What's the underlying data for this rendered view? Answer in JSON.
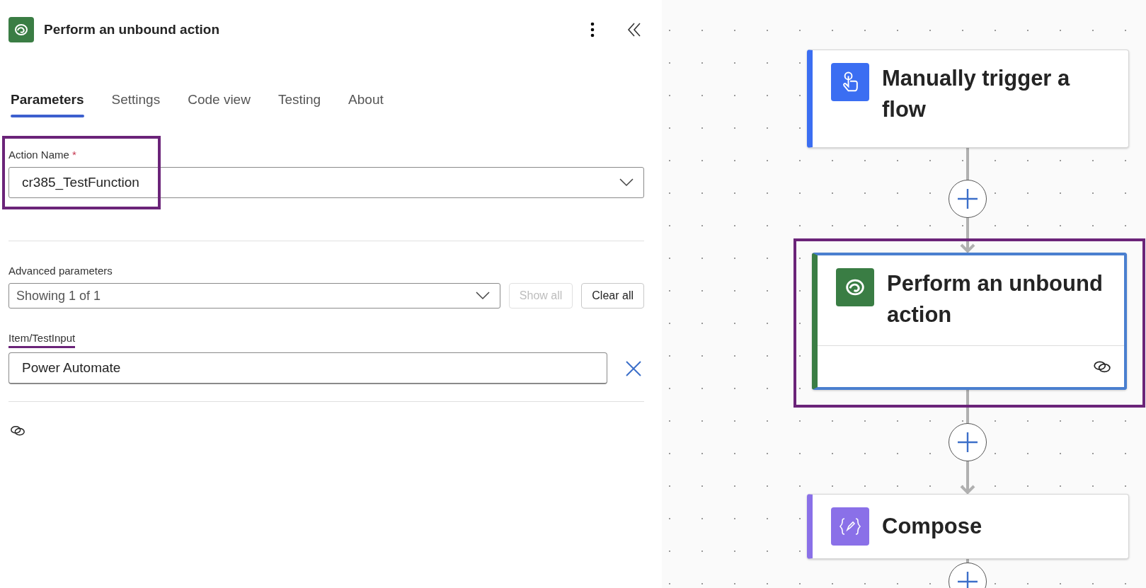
{
  "panel": {
    "title": "Perform an unbound action",
    "tabs": [
      {
        "label": "Parameters",
        "selected": true
      },
      {
        "label": "Settings",
        "selected": false
      },
      {
        "label": "Code view",
        "selected": false
      },
      {
        "label": "Testing",
        "selected": false
      },
      {
        "label": "About",
        "selected": false
      }
    ],
    "action_name": {
      "label": "Action Name",
      "required": "*",
      "value": "cr385_TestFunction",
      "annotated": true
    },
    "advanced": {
      "label": "Advanced parameters",
      "value": "Showing 1 of 1",
      "buttons": [
        {
          "label": "Show all",
          "disabled": true
        },
        {
          "label": "Clear all",
          "disabled": false
        }
      ]
    },
    "item_input": {
      "label": "Item/TestInput",
      "value": "Power Automate",
      "underlined": true
    }
  },
  "canvas": {
    "nodes": [
      {
        "kind": "trigger",
        "title": "Manually trigger a flow",
        "color": "#3b6ef2",
        "selected": false,
        "annotated": false,
        "linked": false
      },
      {
        "kind": "dataverse",
        "title": "Perform an unbound action",
        "color": "#3a7d44",
        "selected": true,
        "annotated": true,
        "linked": true
      },
      {
        "kind": "compose",
        "title": "Compose",
        "color": "#8a70e8",
        "selected": false,
        "annotated": false,
        "linked": false
      }
    ]
  }
}
